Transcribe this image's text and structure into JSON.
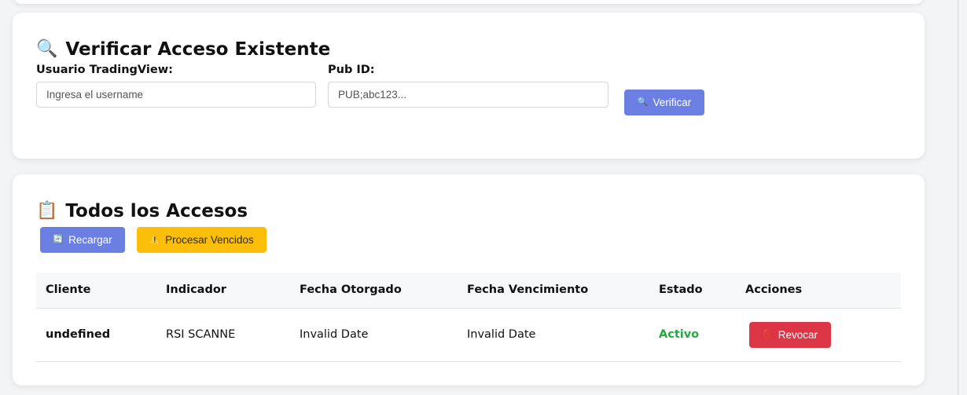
{
  "verify": {
    "icon": "magnifier-icon",
    "title": "Verificar Acceso Existente",
    "user_label": "Usuario TradingView:",
    "user_placeholder": "Ingresa el username",
    "pubid_label": "Pub ID:",
    "pubid_placeholder": "PUB;abc123...",
    "verify_button": "Verificar"
  },
  "list": {
    "icon": "clipboard-icon",
    "title": "Todos los Accesos",
    "reload_button": "Recargar",
    "process_button": "Procesar Vencidos",
    "columns": [
      "Cliente",
      "Indicador",
      "Fecha Otorgado",
      "Fecha Vencimiento",
      "Estado",
      "Acciones"
    ],
    "rows": [
      {
        "client": "undefined",
        "indicator": "RSI SCANNE",
        "granted": "Invalid Date",
        "expires": "Invalid Date",
        "status": "Activo",
        "action": "Revocar"
      }
    ]
  },
  "colors": {
    "primary": "#6b7fe3",
    "warning": "#fbbf0a",
    "danger": "#dc3545",
    "success": "#28a745"
  }
}
